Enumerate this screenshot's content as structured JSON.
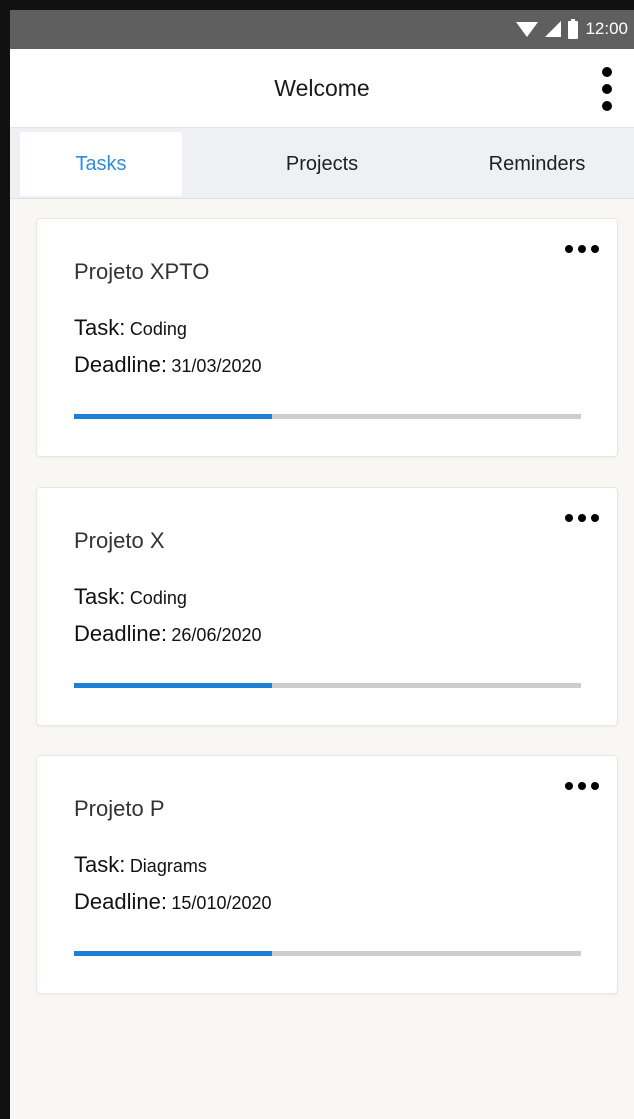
{
  "status_bar": {
    "time": "12:00",
    "icons": [
      "wifi-icon",
      "signal-icon",
      "battery-icon"
    ]
  },
  "app_bar": {
    "title": "Welcome",
    "menu_icon": "more-vert-icon"
  },
  "tabs": [
    {
      "label": "Tasks",
      "active": true
    },
    {
      "label": "Projects",
      "active": false
    },
    {
      "label": "Reminders",
      "active": false
    }
  ],
  "cards": [
    {
      "project": "Projeto XPTO",
      "task_label": "Task:",
      "task": "Coding",
      "deadline_label": "Deadline:",
      "deadline": "31/03/2020",
      "progress": 0.39
    },
    {
      "project": "Projeto X",
      "task_label": "Task:",
      "task": "Coding",
      "deadline_label": "Deadline:",
      "deadline": "26/06/2020",
      "progress": 0.39
    },
    {
      "project": "Projeto P",
      "task_label": "Task:",
      "task": "Diagrams",
      "deadline_label": "Deadline:",
      "deadline": "15/010/2020",
      "progress": 0.39
    }
  ],
  "colors": {
    "accent": "#2f8cde",
    "progress_fill": "#1f7fd4",
    "progress_track": "#cdcdcd",
    "status_bar": "#5f5f5f",
    "background": "#f8f7f3"
  }
}
